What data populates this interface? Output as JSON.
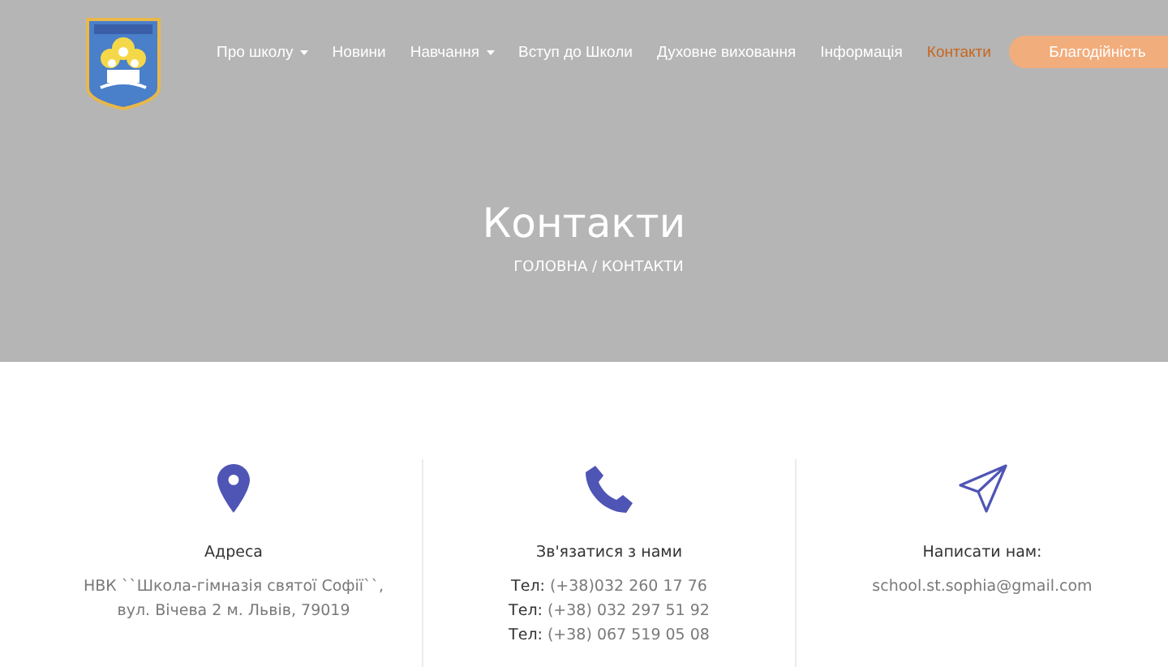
{
  "nav": {
    "items": [
      {
        "label": "Про школу",
        "dropdown": true,
        "selected": false
      },
      {
        "label": "Новини",
        "dropdown": false,
        "selected": false
      },
      {
        "label": "Навчання",
        "dropdown": true,
        "selected": false
      },
      {
        "label": "Вступ до Школи",
        "dropdown": false,
        "selected": false
      },
      {
        "label": "Духовне виховання",
        "dropdown": false,
        "selected": false
      },
      {
        "label": "Інформація",
        "dropdown": false,
        "selected": false
      },
      {
        "label": "Контакти",
        "dropdown": false,
        "selected": true
      }
    ],
    "button": "Благодійність"
  },
  "banner": {
    "title": "Контакти",
    "breadcrumb": "ГОЛОВНА / КОНТАКТИ"
  },
  "contacts": [
    {
      "kind": "address",
      "heading": "Адреса",
      "lines": [
        {
          "text": "НВК ``Школа-гімназія святої Софії``,"
        },
        {
          "text": "вул. Вічева 2 м. Львів, 79019"
        }
      ]
    },
    {
      "kind": "phone",
      "heading": "Зв'язатися з нами",
      "lines": [
        {
          "label": "Тел:",
          "text": "(+38)032 260 17 76"
        },
        {
          "label": "Тел:",
          "text": "(+38) 032 297 51 92"
        },
        {
          "label": "Тел:",
          "text": "(+38) 067 519 05 08"
        }
      ]
    },
    {
      "kind": "email",
      "heading": "Написати нам:",
      "lines": [
        {
          "text": "school.st.sophia@gmail.com"
        }
      ]
    }
  ]
}
